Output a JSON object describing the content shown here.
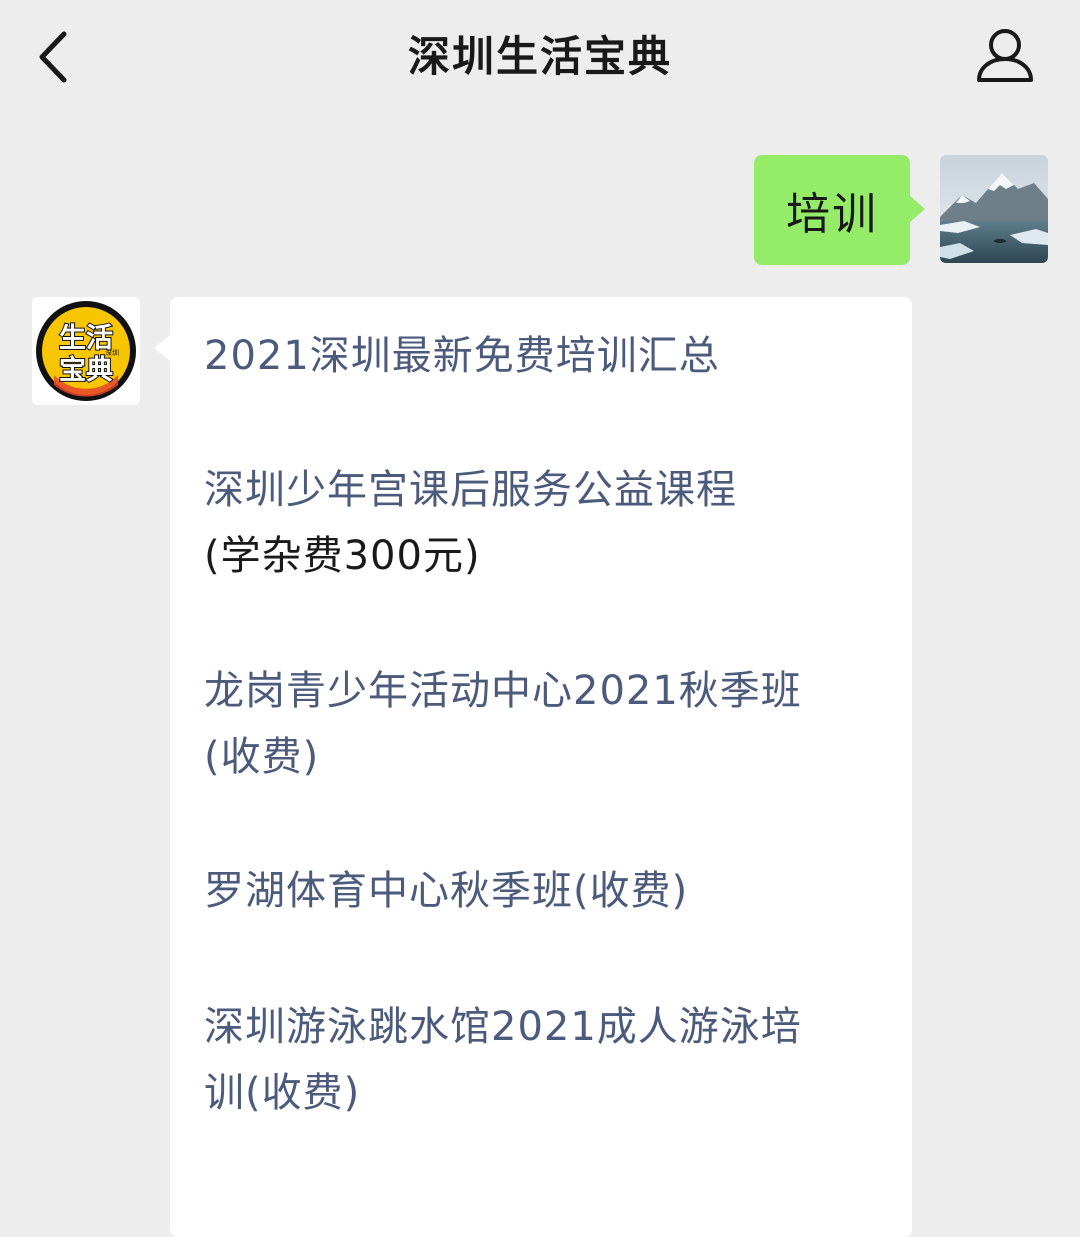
{
  "header": {
    "title": "深圳生活宝典",
    "back_icon": "chevron-left-icon",
    "profile_icon": "person-icon"
  },
  "user_message": {
    "text": "培训",
    "bubble_color": "#95ec69"
  },
  "bot_avatar": {
    "line1": "生活",
    "line2": "宝典",
    "tag": "深圳",
    "colors": {
      "ring": "#111111",
      "fill": "#f7c600",
      "accent": "#e8452c"
    }
  },
  "bot_message": {
    "link_color": "#4c5a7c",
    "items": [
      {
        "line1": "2021深圳最新免费培训汇总"
      },
      {
        "line1": "深圳少年宫课后服务公益课程",
        "line2": "(学杂费300元)"
      },
      {
        "line1": "龙岗青少年活动中心2021秋季班",
        "line2": "(收费)"
      },
      {
        "line1": "罗湖体育中心秋季班(收费)"
      },
      {
        "line1": "深圳游泳跳水馆2021成人游泳培",
        "line2": "训(收费)"
      }
    ]
  }
}
